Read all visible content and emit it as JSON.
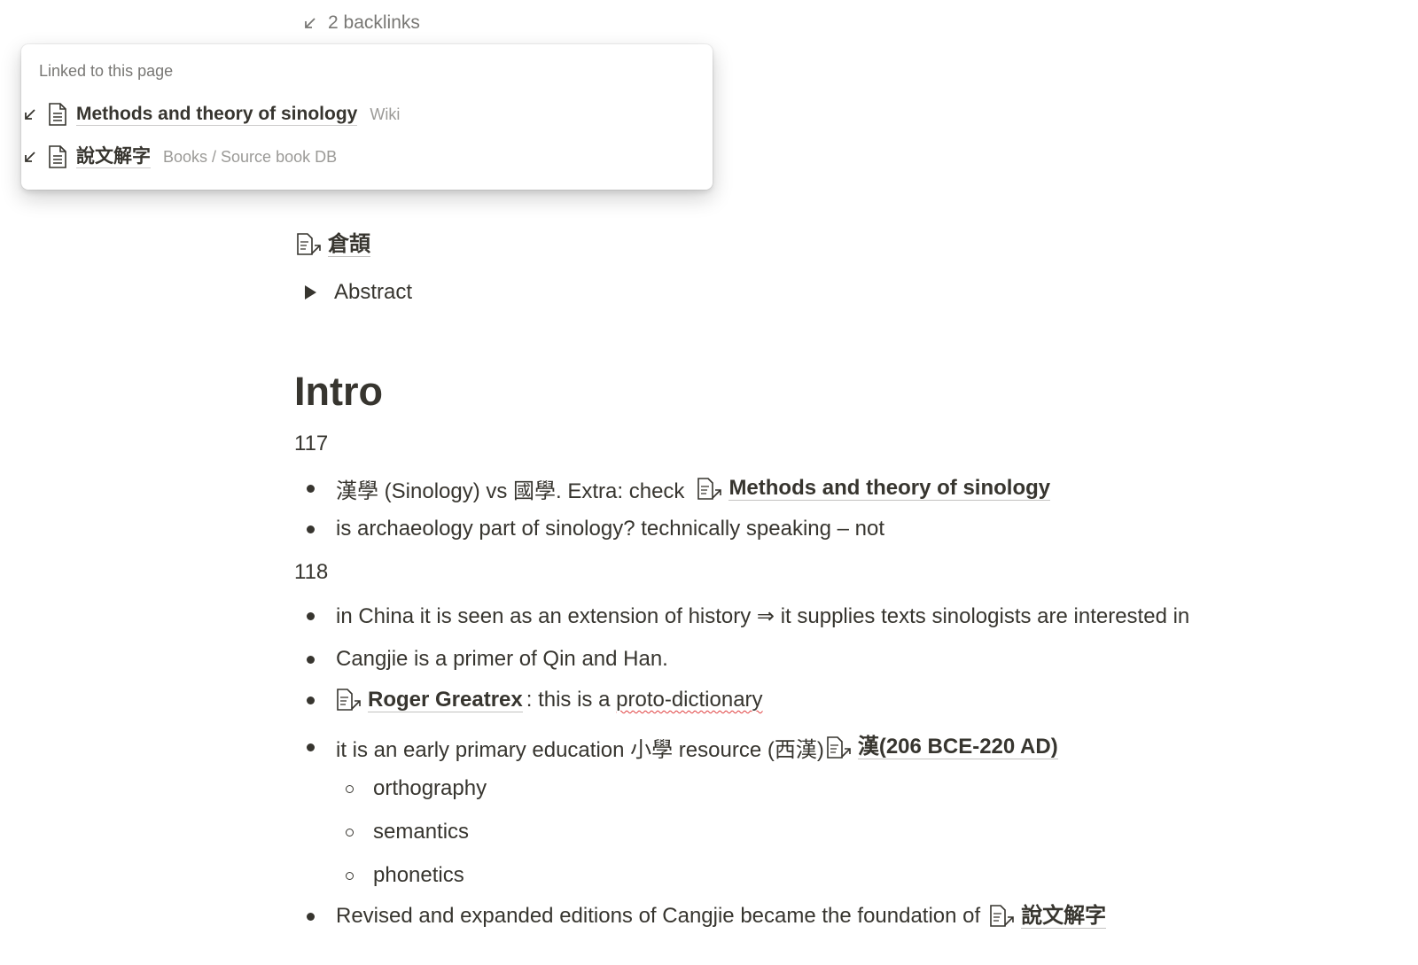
{
  "backlinks": {
    "label": "2 backlinks"
  },
  "popup": {
    "title": "Linked to this page",
    "items": [
      {
        "name": "Methods and theory of sinology",
        "path": "Wiki"
      },
      {
        "name": "說文解字",
        "path": "Books / Source book DB"
      }
    ]
  },
  "page": {
    "mention_top": "倉頡",
    "toggle_label": "Abstract",
    "heading": "Intro",
    "page_117": "117",
    "b1_prefix": "漢學 (Sinology) vs 國學. Extra: check",
    "b1_link": "Methods and theory of sinology",
    "b2": "is archaeology part of sinology? technically speaking – not",
    "page_118": "118",
    "b3": "in China it is seen as an extension of history ⇒ it supplies texts sinologists are interested in",
    "b4": "Cangjie is a primer of Qin and Han.",
    "b5_link": "Roger Greatrex",
    "b5_mid": ": this is a ",
    "b5_word": "proto-dictionary",
    "b6_prefix": "it is an early primary education 小學 resource (西漢)",
    "b6_link": "漢(206 BCE-220 AD)",
    "sub1": "orthography",
    "sub2": "semantics",
    "sub3": "phonetics",
    "b7_prefix": "Revised and expanded editions of Cangjie became the foundation of",
    "b7_link": "說文解字"
  },
  "colors": {
    "text": "#37352f",
    "muted": "#787774",
    "faint": "#9b9a97",
    "spell": "#e03e3e"
  }
}
